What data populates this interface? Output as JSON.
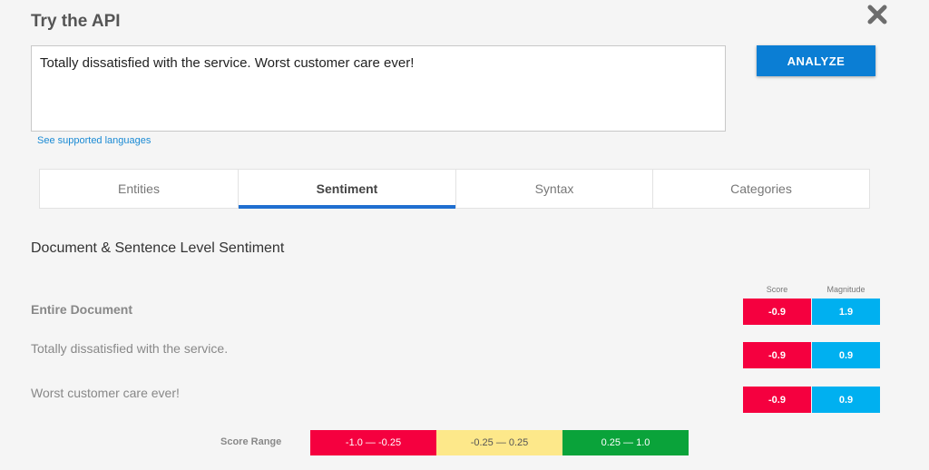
{
  "header": {
    "title": "Try the API"
  },
  "input": {
    "text": "Totally dissatisfied with the service. Worst customer care ever!"
  },
  "actions": {
    "analyze_label": "ANALYZE"
  },
  "links": {
    "supported_languages": "See supported languages"
  },
  "tabs": [
    {
      "label": "Entities"
    },
    {
      "label": "Sentiment",
      "active": true
    },
    {
      "label": "Syntax"
    },
    {
      "label": "Categories"
    }
  ],
  "section": {
    "title": "Document & Sentence Level Sentiment"
  },
  "columns": {
    "score": "Score",
    "magnitude": "Magnitude"
  },
  "rows": [
    {
      "label": "Entire Document",
      "score": "-0.9",
      "magnitude": "1.9"
    },
    {
      "label": "Totally dissatisfied with the service.",
      "score": "-0.9",
      "magnitude": "0.9"
    },
    {
      "label": "Worst customer care ever!",
      "score": "-0.9",
      "magnitude": "0.9"
    }
  ],
  "score_range": {
    "label": "Score Range",
    "segments": [
      {
        "text": "-1.0 — -0.25",
        "color": "#f5003f"
      },
      {
        "text": "-0.25 — 0.25",
        "color": "#fde88a"
      },
      {
        "text": "0.25 — 1.0",
        "color": "#0aa33a"
      }
    ]
  },
  "colors": {
    "accent": "#0b7ed4",
    "tab_indicator": "#1f6fd0",
    "score": "#f5003f",
    "magnitude": "#00b0f0"
  },
  "icons": {
    "close": "close-icon"
  }
}
